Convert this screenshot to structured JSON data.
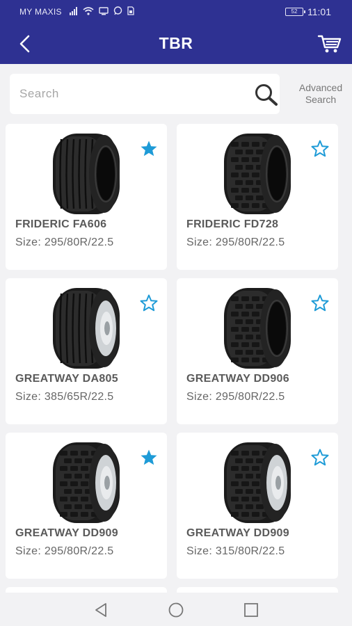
{
  "status_bar": {
    "carrier": "MY MAXIS",
    "battery": "52",
    "time": "11:01"
  },
  "header": {
    "back_icon": "back-arrow-icon",
    "title": "TBR",
    "cart_icon": "cart-icon"
  },
  "search": {
    "placeholder": "Search",
    "icon": "search-icon",
    "advanced_line1": "Advanced",
    "advanced_line2": "Search"
  },
  "products": [
    {
      "name": "FRIDERIC FA606",
      "size": "Size: 295/80R/22.5",
      "favorite": true,
      "tread": "rib"
    },
    {
      "name": "FRIDERIC FD728",
      "size": "Size: 295/80R/22.5",
      "favorite": false,
      "tread": "block"
    },
    {
      "name": "GREATWAY DA805",
      "size": "Size: 385/65R/22.5",
      "favorite": false,
      "tread": "rib-wheel"
    },
    {
      "name": "GREATWAY DD906",
      "size": "Size: 295/80R/22.5",
      "favorite": false,
      "tread": "block"
    },
    {
      "name": "GREATWAY DD909",
      "size": "Size: 295/80R/22.5",
      "favorite": true,
      "tread": "block-wheel"
    },
    {
      "name": "GREATWAY DD909",
      "size": "Size: 315/80R/22.5",
      "favorite": false,
      "tread": "block-wheel"
    }
  ],
  "colors": {
    "brand": "#2e3192",
    "star": "#1e9bd7",
    "card": "#ffffff",
    "background": "#f2f2f4"
  },
  "nav": {
    "back": "triangle-back-icon",
    "home": "circle-home-icon",
    "recents": "square-recents-icon"
  }
}
